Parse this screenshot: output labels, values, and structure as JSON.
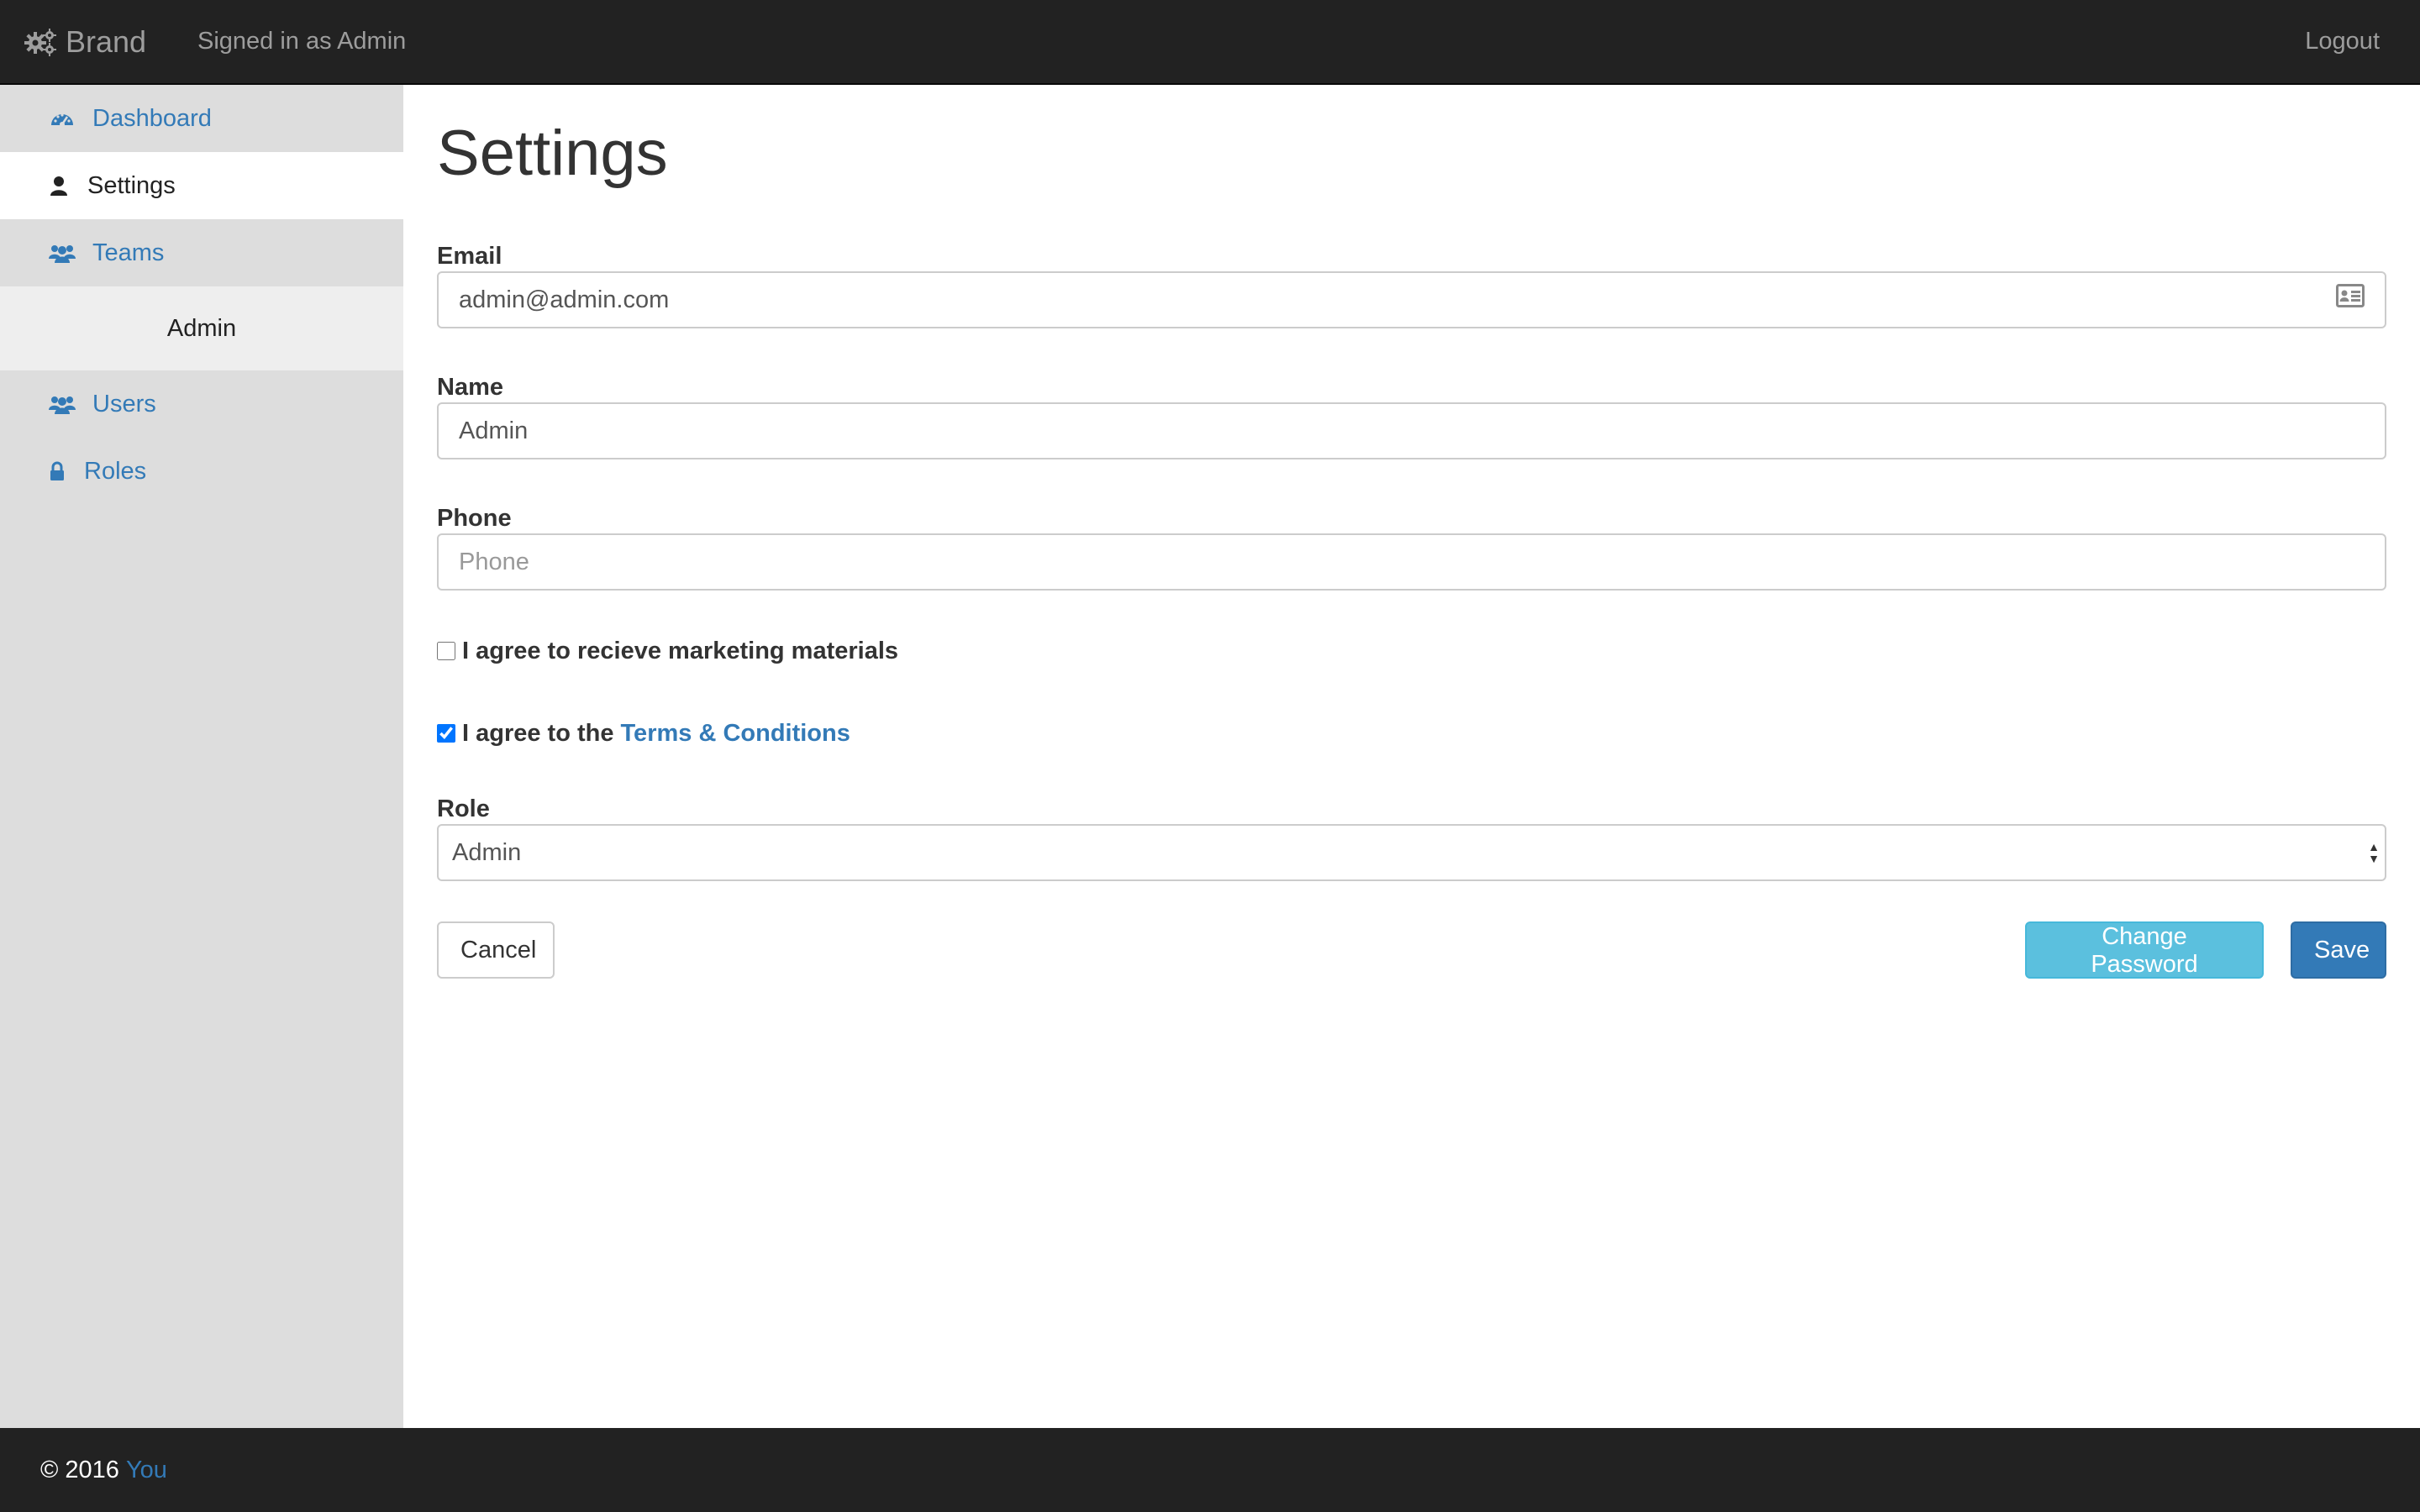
{
  "navbar": {
    "brand": "Brand",
    "signed_in": "Signed in as Admin",
    "logout": "Logout"
  },
  "sidebar": {
    "items": [
      {
        "label": "Dashboard",
        "icon": "dashboard-icon"
      },
      {
        "label": "Settings",
        "icon": "user-icon"
      },
      {
        "label": "Teams",
        "icon": "users-icon"
      },
      {
        "label": "Admin"
      },
      {
        "label": "Users",
        "icon": "users-icon"
      },
      {
        "label": "Roles",
        "icon": "lock-icon"
      }
    ]
  },
  "main": {
    "title": "Settings",
    "email": {
      "label": "Email",
      "value": "admin@admin.com"
    },
    "name": {
      "label": "Name",
      "value": "Admin"
    },
    "phone": {
      "label": "Phone",
      "value": "",
      "placeholder": "Phone"
    },
    "marketing": {
      "label": "I agree to recieve marketing materials",
      "checked": false
    },
    "terms": {
      "label_prefix": "I agree to the",
      "link": "Terms & Conditions",
      "checked": true
    },
    "role": {
      "label": "Role",
      "selected": "Admin"
    },
    "buttons": {
      "cancel": "Cancel",
      "change_password": "Change Password",
      "save": "Save"
    }
  },
  "footer": {
    "copyright": "© 2016",
    "link": "You"
  },
  "colors": {
    "navbar_bg": "#222222",
    "sidebar_bg": "#dddddd",
    "link": "#337ab7",
    "info": "#5bc0de",
    "primary": "#337ab7"
  }
}
